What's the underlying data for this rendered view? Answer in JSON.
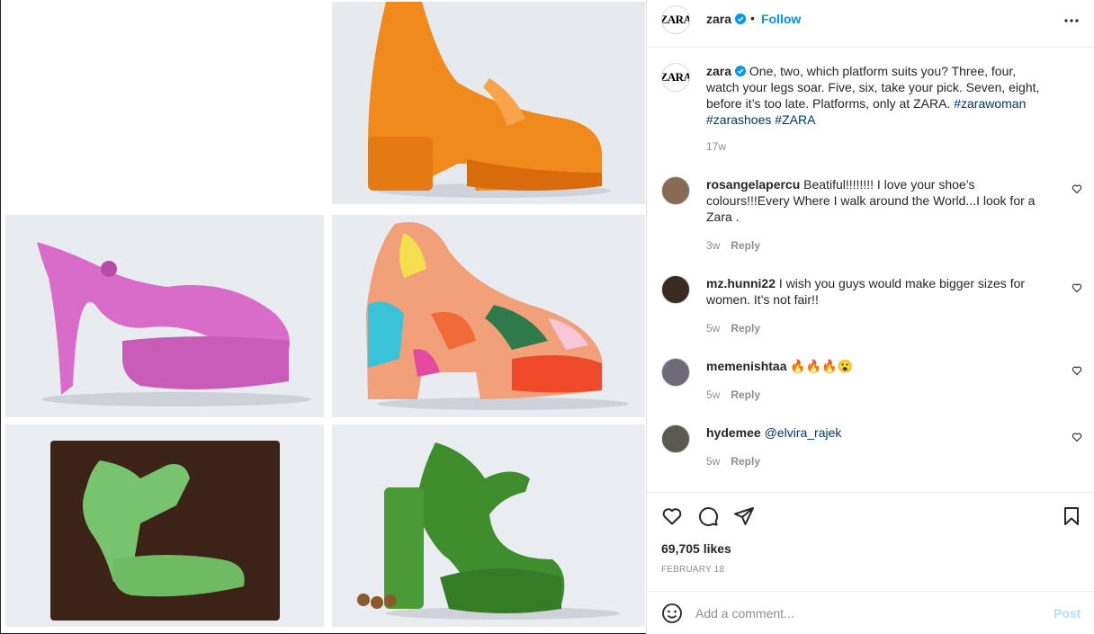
{
  "post": {
    "username": "zara",
    "follow_label": "Follow",
    "separator": "•",
    "caption": "One, two, which platform suits you? Three, four, watch your legs soar. Five, six, take your pick. Seven, eight, before it’s too late. Platforms, only at ZARA.",
    "hashtags": [
      "#zarawoman",
      "#zarashoes",
      "#ZARA"
    ],
    "caption_age": "17w",
    "logo_text": "ZARA",
    "likes": "69,705 likes",
    "date": "FEBRUARY 18"
  },
  "comments": [
    {
      "user": "rosangelapercu",
      "text": "Beatiful!!!!!!!! I love your shoe’s colours!!!Every Where I walk around the World...I look for a Zara .",
      "age": "3w",
      "reply": "Reply"
    },
    {
      "user": "mz.hunni22",
      "text": "I wish you guys would make bigger sizes for women. It's not fair!!",
      "age": "5w",
      "reply": "Reply"
    },
    {
      "user": "memenishtaa",
      "text": "🔥🔥🔥😮",
      "age": "5w",
      "reply": "Reply"
    },
    {
      "user": "hydemee",
      "text": "@elvira_rajek",
      "age": "5w",
      "reply": "Reply"
    }
  ],
  "add_comment": {
    "placeholder": "Add a comment...",
    "post_label": "Post"
  },
  "colors": {
    "accent": "#0095f6",
    "link": "#00376b",
    "muted": "#8e8e8e",
    "post_disabled": "#b2dffc"
  },
  "icons": [
    "verified-badge-icon",
    "more-options-icon",
    "heart-icon",
    "comment-icon",
    "share-icon",
    "bookmark-icon",
    "emoji-icon"
  ]
}
